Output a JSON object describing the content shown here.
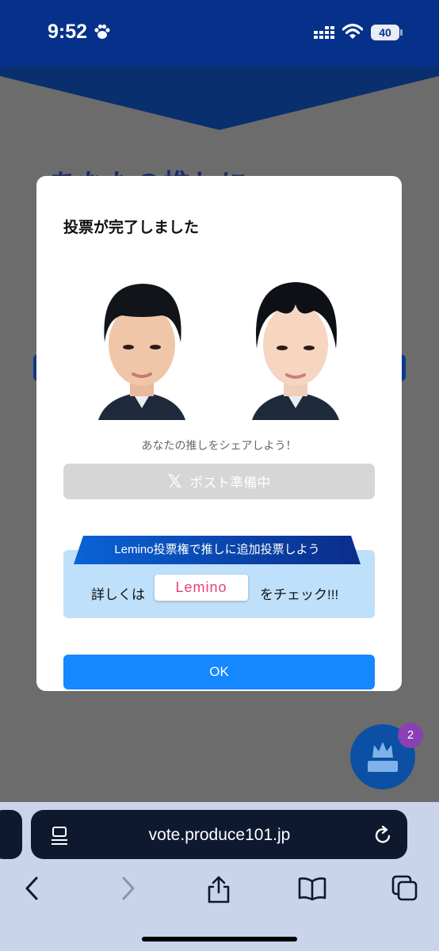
{
  "status_bar": {
    "time": "9:52",
    "battery": "40"
  },
  "background": {
    "heading": "あなたの推しに"
  },
  "modal": {
    "title": "投票が完了しました",
    "share_text": "あなたの推しをシェアしよう！",
    "post_button": "ポスト準備中",
    "promo": {
      "ribbon": "Lemino投票権で推しに追加投票しよう",
      "before": "詳しくは",
      "logo": "Lemino",
      "after": "をチェック!!!"
    },
    "ok_button": "OK"
  },
  "fab": {
    "badge": "2"
  },
  "browser": {
    "url": "vote.produce101.jp"
  },
  "colors": {
    "header": "#05318a",
    "ok": "#1588ff",
    "promo_bg": "#bfe0fa",
    "disabled": "#d6d6d6"
  }
}
